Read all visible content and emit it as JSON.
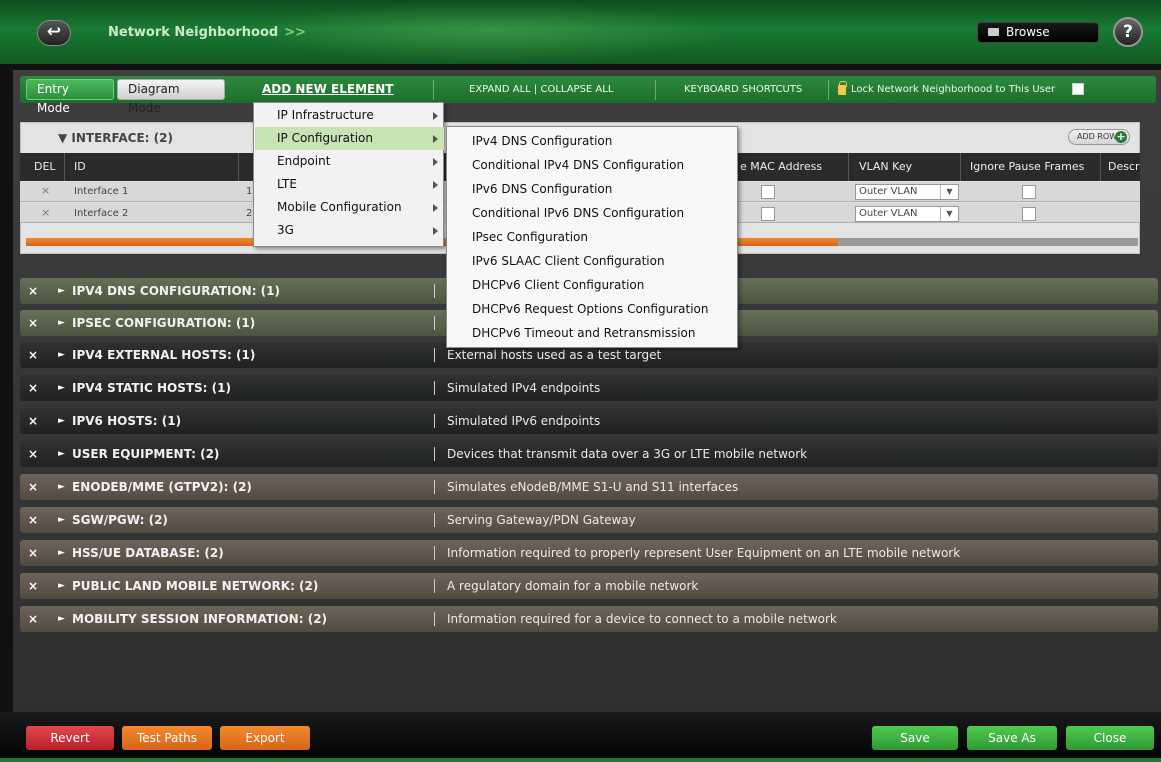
{
  "header": {
    "breadcrumb": "Network Neighborhood",
    "breadcrumb_arrows": ">>",
    "browse_label": "Browse",
    "help_label": "?"
  },
  "toolbar": {
    "entry_mode": "Entry Mode",
    "diagram_mode": "Diagram Mode",
    "add_new_element": "ADD NEW ELEMENT",
    "expand_collapse": "EXPAND ALL | COLLAPSE ALL",
    "keyboard_shortcuts": "KEYBOARD SHORTCUTS",
    "lock_label": "Lock Network Neighborhood to This User"
  },
  "interface": {
    "title": "INTERFACE: (2)",
    "add_row": "ADD ROW",
    "columns": [
      "DEL",
      "ID",
      "e MAC Address",
      "VLAN Key",
      "Ignore Pause Frames",
      "Descr"
    ],
    "rows": [
      {
        "del": "×",
        "id": "Interface 1",
        "col2": "1",
        "vlan": "Outer VLAN"
      },
      {
        "del": "×",
        "id": "Interface 2",
        "col2": "2",
        "vlan": "Outer VLAN"
      }
    ],
    "scroll_progress": 0.73
  },
  "menu_level1": [
    {
      "label": "IP Infrastructure",
      "highlighted": false
    },
    {
      "label": "IP Configuration",
      "highlighted": true
    },
    {
      "label": "Endpoint",
      "highlighted": false
    },
    {
      "label": "LTE",
      "highlighted": false
    },
    {
      "label": "Mobile Configuration",
      "highlighted": false
    },
    {
      "label": "3G",
      "highlighted": false
    }
  ],
  "menu_level2": [
    "IPv4 DNS Configuration",
    "Conditional IPv4 DNS Configuration",
    "IPv6 DNS Configuration",
    "Conditional IPv6 DNS Configuration",
    "IPsec Configuration",
    "IPv6 SLAAC Client Configuration",
    "DHCPv6 Client Configuration",
    "DHCPv6 Request Options Configuration",
    "DHCPv6 Timeout and Retransmission"
  ],
  "sections": [
    {
      "title": "IPV4 DNS CONFIGURATION: (1)",
      "desc": "",
      "style": "olive"
    },
    {
      "title": "IPSEC CONFIGURATION: (1)",
      "desc": "",
      "style": "olive"
    },
    {
      "title": "IPV4 EXTERNAL HOSTS: (1)",
      "desc": "External hosts used as a test target",
      "style": "dark"
    },
    {
      "title": "IPV4 STATIC HOSTS: (1)",
      "desc": "Simulated IPv4 endpoints",
      "style": "dark"
    },
    {
      "title": "IPV6 HOSTS: (1)",
      "desc": "Simulated IPv6 endpoints",
      "style": "dark"
    },
    {
      "title": "USER EQUIPMENT: (2)",
      "desc": "Devices that transmit data over a 3G or LTE mobile network",
      "style": "dark"
    },
    {
      "title": "ENODEB/MME (GTPV2): (2)",
      "desc": "Simulates eNodeB/MME S1-U and S11 interfaces",
      "style": "brown"
    },
    {
      "title": "SGW/PGW: (2)",
      "desc": "Serving Gateway/PDN Gateway",
      "style": "brown"
    },
    {
      "title": "HSS/UE DATABASE: (2)",
      "desc": "Information required to properly represent User Equipment on an LTE mobile network",
      "style": "brown"
    },
    {
      "title": "PUBLIC LAND MOBILE NETWORK: (2)",
      "desc": "A regulatory domain for a mobile network",
      "style": "brown"
    },
    {
      "title": "MOBILITY SESSION INFORMATION: (2)",
      "desc": "Information required for a device to connect to a mobile network",
      "style": "brown"
    }
  ],
  "bottom": {
    "revert": "Revert",
    "test_paths": "Test Paths",
    "export": "Export",
    "save": "Save",
    "save_as": "Save As",
    "close": "Close"
  },
  "colors": {
    "accent_green": "#1e6d2d",
    "revert_red": "#c9303a",
    "action_orange": "#e07220",
    "save_green": "#3cae40"
  }
}
